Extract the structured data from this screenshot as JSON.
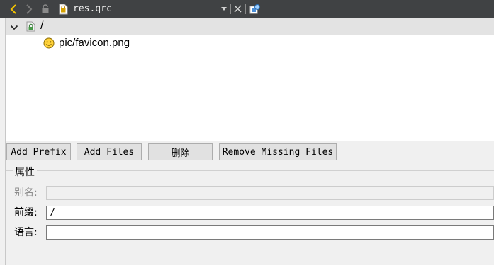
{
  "editor": {
    "file_name": "res.qrc",
    "tree": {
      "root": {
        "label": "/",
        "expanded": true
      },
      "children": [
        {
          "label": "pic/favicon.png"
        }
      ]
    },
    "buttons": {
      "add_prefix": "Add Prefix",
      "add_files": "Add Files",
      "delete": "删除",
      "remove_missing": "Remove Missing Files"
    },
    "properties": {
      "title": "属性",
      "alias_label": "别名:",
      "alias_value": "",
      "prefix_label": "前缀:",
      "prefix_value": "/",
      "language_label": "语言:",
      "language_value": ""
    }
  },
  "colors": {
    "toolbar_bg": "#404244",
    "accent_yellow": "#f5c400",
    "selected_row": "#e3e3e3",
    "button_bg": "#e1e1e1"
  },
  "icons": [
    "back-arrow-icon",
    "forward-arrow-icon",
    "lock-icon",
    "qrc-file-icon",
    "dropdown-arrow-icon",
    "close-icon",
    "split-icon",
    "folder-prefix-icon",
    "smiley-favicon-icon",
    "expand-chevron-icon"
  ]
}
